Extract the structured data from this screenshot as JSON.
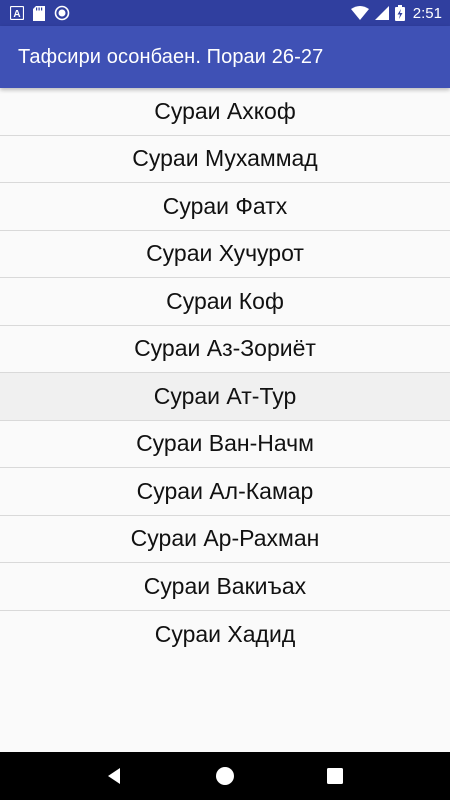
{
  "status_bar": {
    "time": "2:51",
    "icons": [
      "a-notification-icon",
      "sd-card-icon",
      "record-icon",
      "wifi-icon",
      "signal-icon",
      "battery-charging-icon"
    ]
  },
  "app_bar": {
    "title": "Тафсири осонбаен. Пораи 26-27",
    "color": "#3f51b5"
  },
  "list": {
    "items": [
      "Сураи Ахкоф",
      "Сураи Мухаммад",
      "Сураи Фатх",
      "Сураи Хучурот",
      "Сураи Коф",
      "Сураи Аз-Зориёт",
      "Сураи Ат-Тур",
      "Сураи Ван-Начм",
      "Сураи Ал-Камар",
      "Сураи Ар-Рахман",
      "Сураи Вакиъах",
      "Сураи Хадид"
    ]
  },
  "nav_bar": {
    "icons": [
      "back-icon",
      "home-icon",
      "recents-icon"
    ]
  }
}
